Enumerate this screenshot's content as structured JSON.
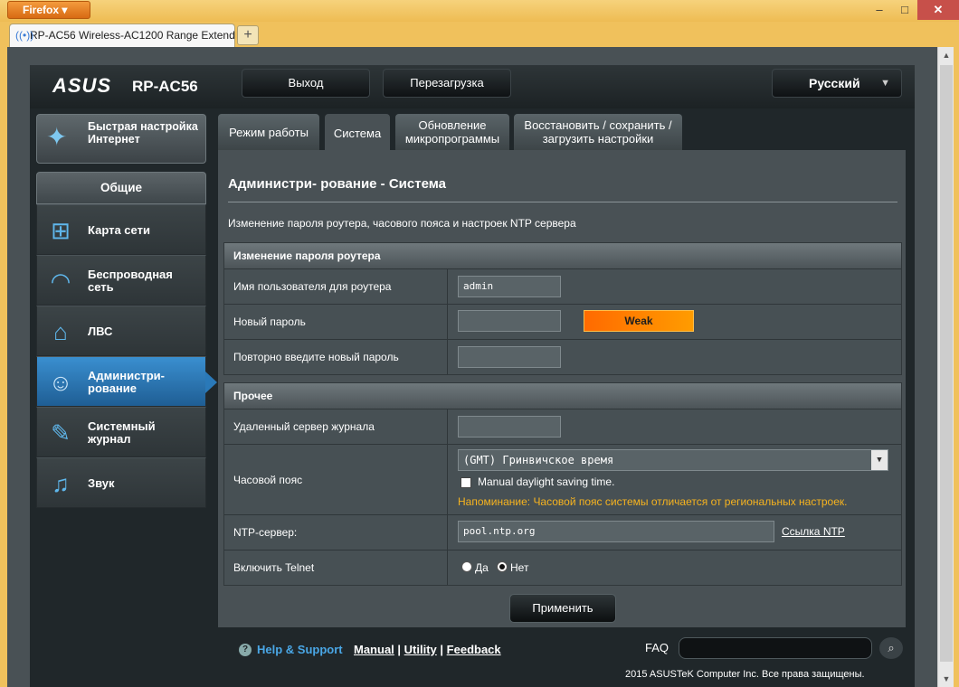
{
  "browser": {
    "app_button": "Firefox",
    "tab_title": "RP-AC56 Wireless-AC1200 Range Extend...",
    "new_tab": "+",
    "minimize": "–",
    "maximize": "□",
    "close": "✕"
  },
  "header": {
    "logo": "ASUS",
    "model": "RP-AC56",
    "logout": "Выход",
    "reboot": "Перезагрузка",
    "language": "Русский"
  },
  "sidebar": {
    "quick_setup": "Быстрая настройка Интернет",
    "section": "Общие",
    "items": [
      {
        "label": "Карта сети",
        "icon": "network-map-icon"
      },
      {
        "label": "Беспроводная сеть",
        "icon": "wifi-icon"
      },
      {
        "label": "ЛВС",
        "icon": "home-icon"
      },
      {
        "label": "Администри- рование",
        "icon": "admin-user-icon"
      },
      {
        "label": "Системный журнал",
        "icon": "log-edit-icon"
      },
      {
        "label": "Звук",
        "icon": "music-note-icon"
      }
    ]
  },
  "tabs": [
    {
      "label": "Режим работы"
    },
    {
      "label": "Система"
    },
    {
      "label": "Обновление микропрограммы"
    },
    {
      "label": "Восстановить / сохранить / загрузить настройки"
    }
  ],
  "content": {
    "title": "Администри- рование - Система",
    "description": "Изменение пароля роутера, часового пояса и настроек NTP сервера",
    "password_section": {
      "header": "Изменение пароля роутера",
      "username_label": "Имя пользователя для роутера",
      "username_value": "admin",
      "new_password_label": "Новый пароль",
      "new_password_value": "",
      "strength": "Weak",
      "repeat_label": "Повторно введите новый пароль",
      "repeat_value": ""
    },
    "misc_section": {
      "header": "Прочее",
      "log_server_label": "Удаленный сервер журнала",
      "log_server_value": "",
      "timezone_label": "Часовой пояс",
      "timezone_value": "(GMT) Гринвичское время",
      "dst_label": "Manual daylight saving time.",
      "reminder": "Напоминание: Часовой пояс системы отличается от региональных настроек.",
      "ntp_label": "NTP-сервер:",
      "ntp_value": "pool.ntp.org",
      "ntp_link": "Ссылка NTP",
      "telnet_label": "Включить Telnet",
      "telnet_yes": "Да",
      "telnet_no": "Нет"
    },
    "apply": "Применить"
  },
  "footer": {
    "help": "Help & Support",
    "manual": "Manual",
    "utility": "Utility",
    "feedback": "Feedback",
    "faq": "FAQ",
    "copyright": "2015 ASUSTeK Computer Inc. Все права защищены."
  }
}
